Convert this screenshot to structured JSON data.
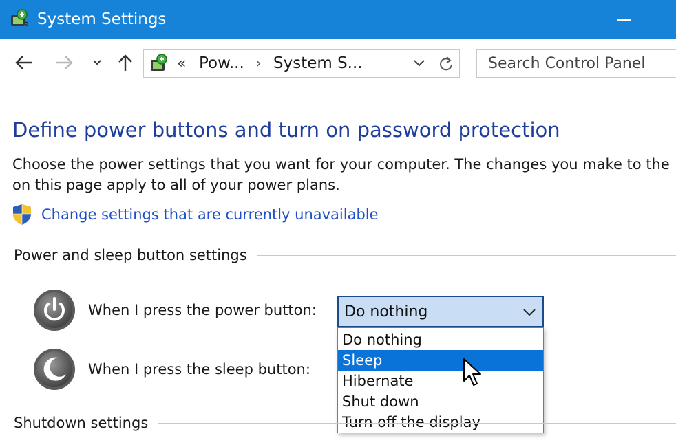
{
  "window": {
    "title": "System Settings",
    "minimize_label": "—"
  },
  "nav": {
    "back_icon": "arrow-left-icon",
    "forward_icon": "arrow-right-icon",
    "recent_icon": "chevron-down-icon",
    "up_icon": "arrow-up-icon"
  },
  "address": {
    "overflow": "«",
    "crumbs": [
      "Pow...",
      "System S..."
    ],
    "separator": "›"
  },
  "search": {
    "placeholder": "Search Control Panel"
  },
  "main": {
    "title": "Define power buttons and turn on password protection",
    "description_lines": [
      "Choose the power settings that you want for your computer. The changes you make to the",
      "on this page apply to all of your power plans."
    ],
    "change_link": "Change settings that are currently unavailable"
  },
  "power_section": {
    "header": "Power and sleep button settings",
    "power_row_label": "When I press the power button:",
    "sleep_row_label": "When I press the sleep button:",
    "power_select_value": "Do nothing",
    "dropdown_options": [
      "Do nothing",
      "Sleep",
      "Hibernate",
      "Shut down",
      "Turn off the display"
    ],
    "highlighted_option": "Sleep"
  },
  "shutdown_section": {
    "header": "Shutdown settings"
  },
  "colors": {
    "titlebar": "#1683d8",
    "heading": "#1e3e9c",
    "link": "#1f4fc8",
    "select_bg": "#c9def5",
    "highlight": "#0a73d9"
  }
}
